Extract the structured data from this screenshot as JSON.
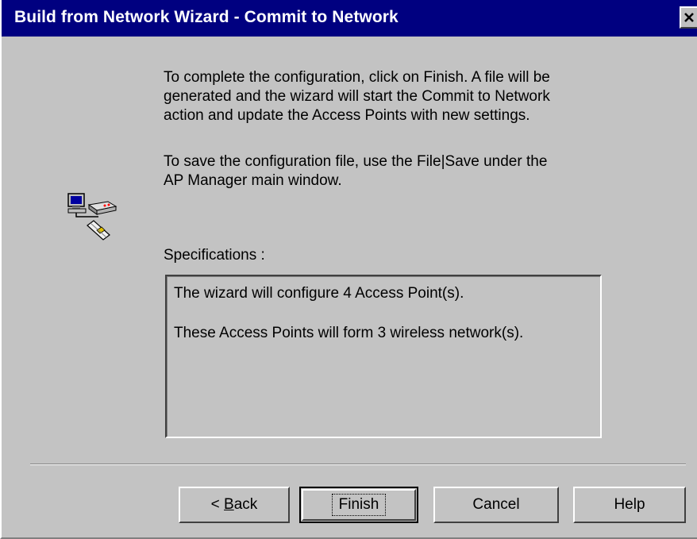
{
  "window": {
    "title": "Build from Network Wizard - Commit to Network",
    "close_glyph": "✕"
  },
  "content": {
    "paragraph1": "To complete the configuration, click on Finish. A file will be\ngenerated and the wizard will start the Commit to Network\naction and update the Access Points with new settings.",
    "paragraph2": "To save the configuration file, use the File|Save under the\nAP Manager main window.",
    "icon": "network-wizard-icon"
  },
  "specifications": {
    "label": "Specifications :",
    "lines": [
      "The wizard will configure 4 Access Point(s).",
      "These Access Points will form 3 wireless network(s)."
    ]
  },
  "buttons": {
    "back_prefix": "< ",
    "back_accel": "B",
    "back_rest": "ack",
    "finish": "Finish",
    "cancel": "Cancel",
    "help": "Help"
  }
}
